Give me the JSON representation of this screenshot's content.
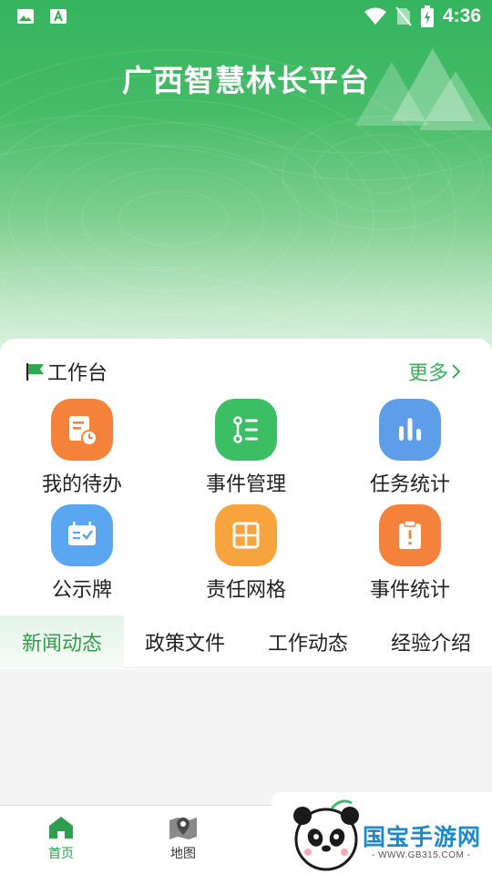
{
  "status_bar": {
    "time": "4:36"
  },
  "app": {
    "title": "广西智慧林长平台"
  },
  "workbench": {
    "title": "工作台",
    "more_label": "更多",
    "items": [
      {
        "label": "我的待办",
        "icon": "todo-clock-icon",
        "color": "#f5823a"
      },
      {
        "label": "事件管理",
        "icon": "event-list-icon",
        "color": "#3cbf64"
      },
      {
        "label": "任务统计",
        "icon": "bar-stats-icon",
        "color": "#5e9de8"
      },
      {
        "label": "公示牌",
        "icon": "notice-board-icon",
        "color": "#5aa6f0"
      },
      {
        "label": "责任网格",
        "icon": "grid-icon",
        "color": "#f7a33e"
      },
      {
        "label": "事件统计",
        "icon": "alert-clipboard-icon",
        "color": "#f5823a"
      }
    ]
  },
  "tabs": [
    {
      "label": "新闻动态",
      "active": true
    },
    {
      "label": "政策文件",
      "active": false
    },
    {
      "label": "工作动态",
      "active": false
    },
    {
      "label": "经验介绍",
      "active": false
    }
  ],
  "bottom_nav": [
    {
      "label": "首页",
      "icon": "home-icon",
      "active": true,
      "color": "#2f9e4e"
    },
    {
      "label": "地图",
      "icon": "map-pin-icon",
      "active": false,
      "color": "#333333"
    }
  ],
  "watermark": {
    "text": "国宝手游网",
    "url": "- WWW.GB315.COM -"
  },
  "colors": {
    "brand_green": "#3fae5b",
    "header_green": "#35b45f"
  }
}
